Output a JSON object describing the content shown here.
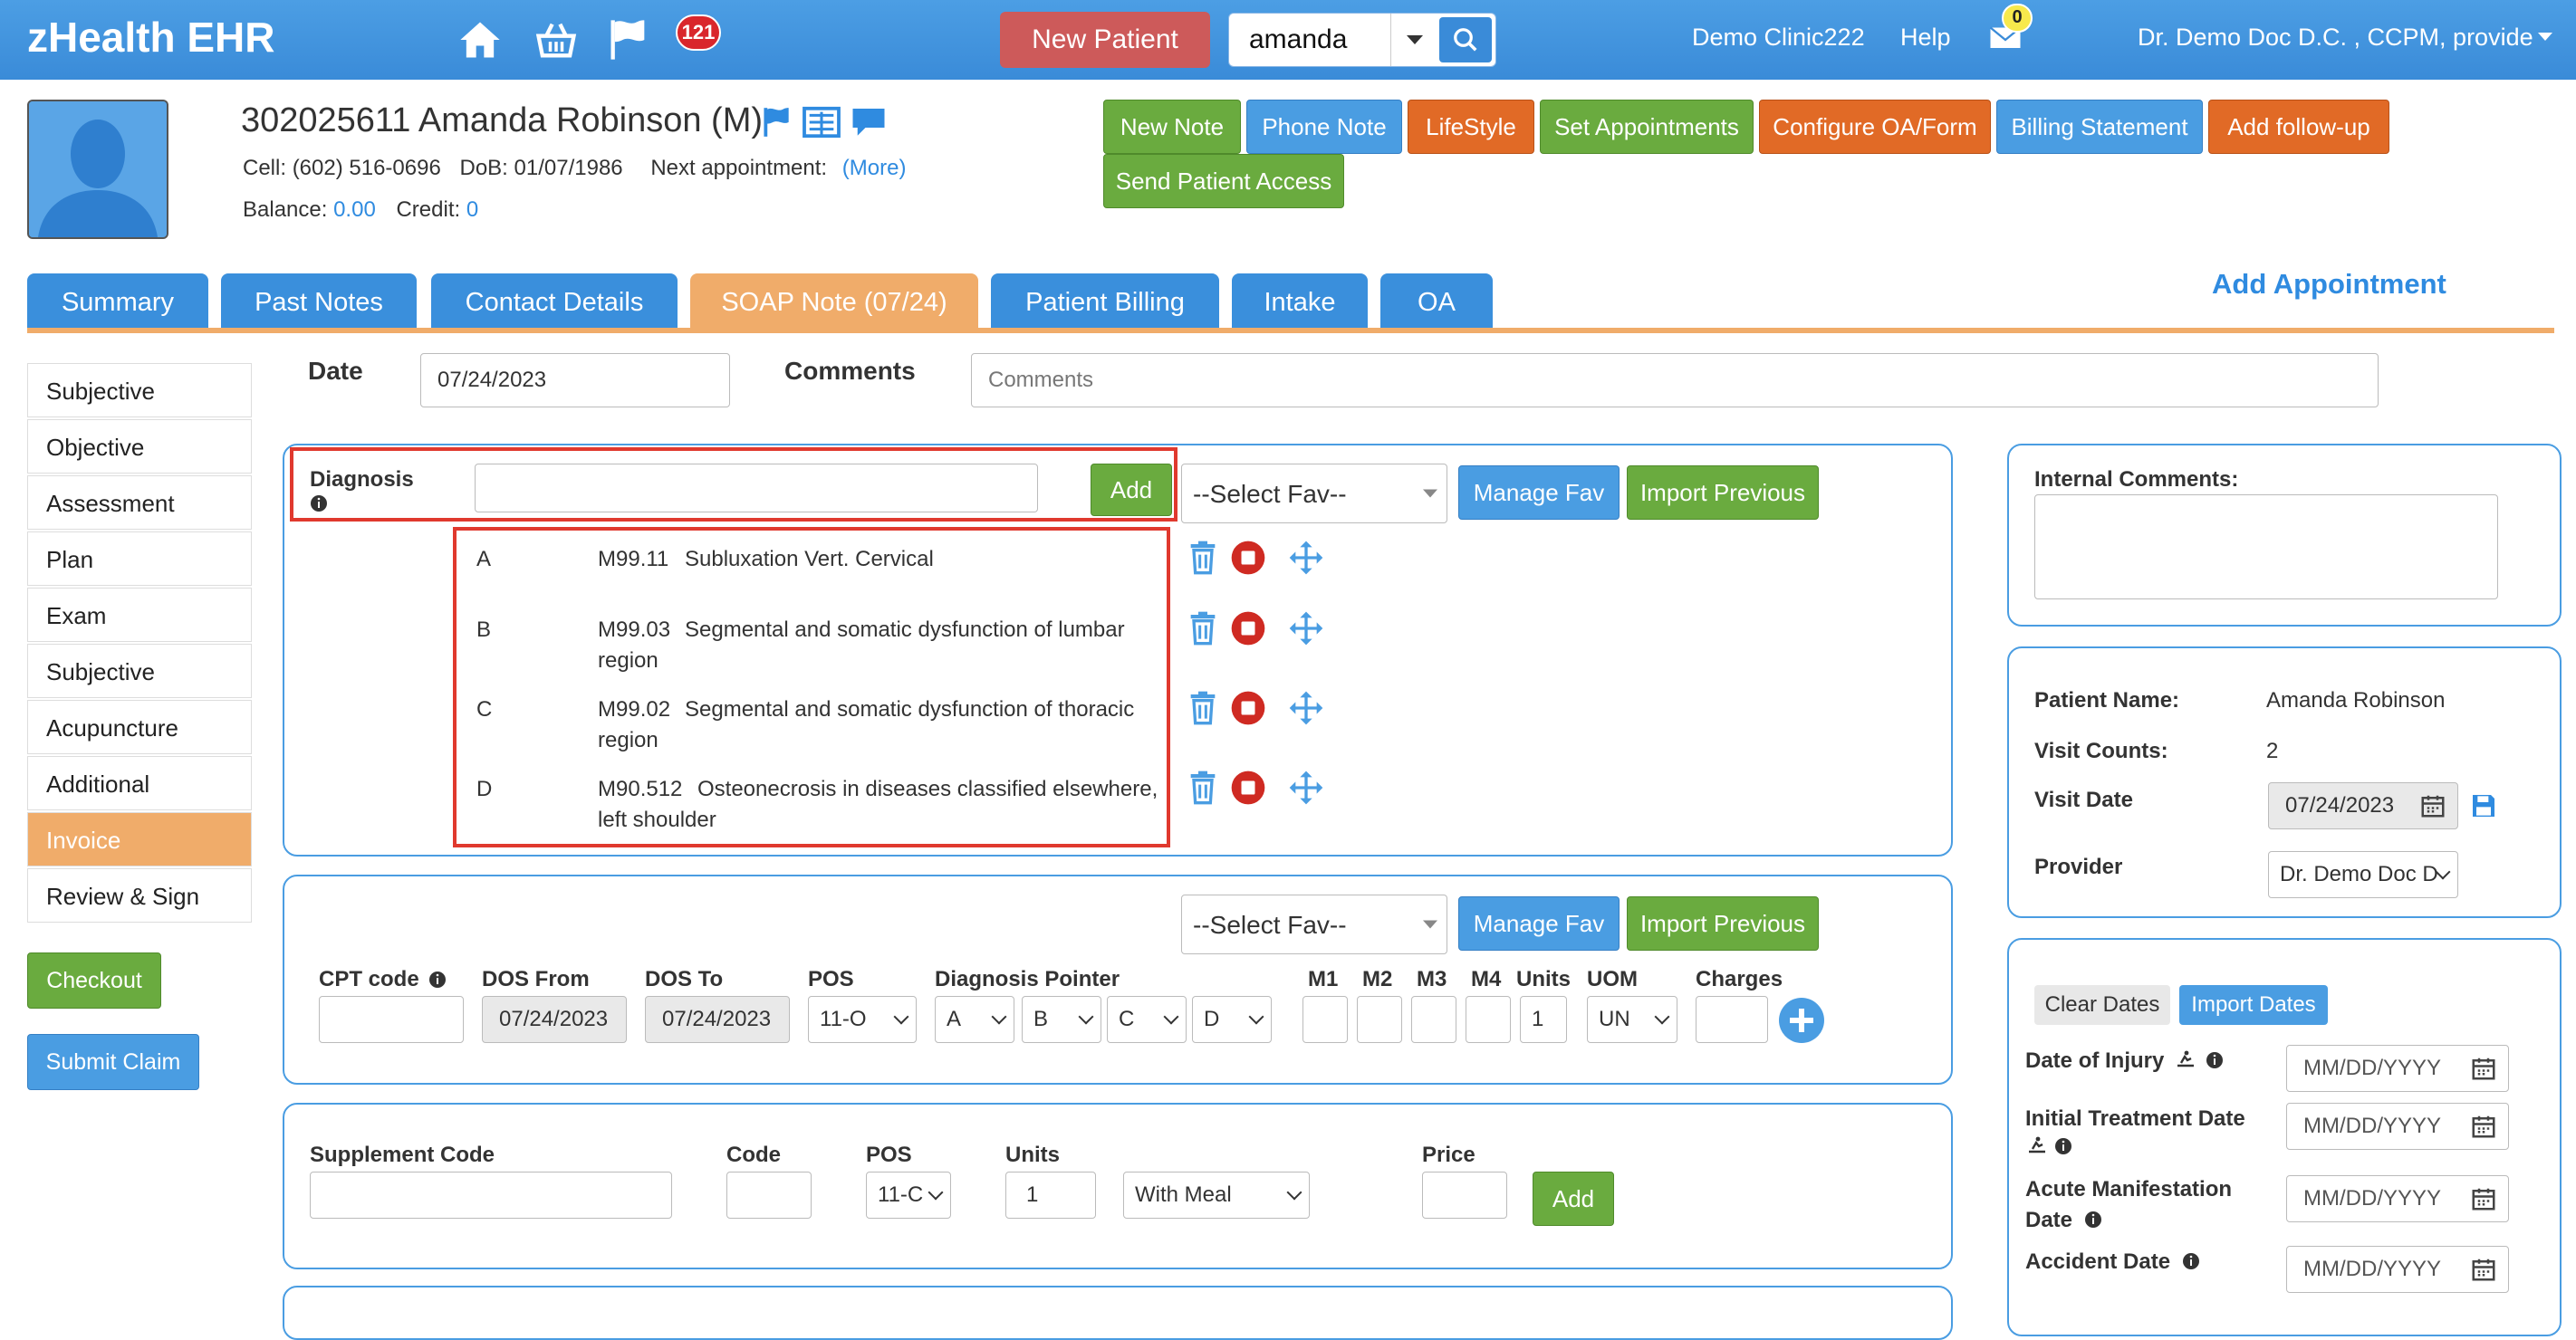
{
  "app": {
    "title": "zHealth EHR",
    "notification_count": "121",
    "message_count": "0"
  },
  "topbar": {
    "new_patient": "New Patient",
    "search_value": "amanda",
    "clinic": "Demo Clinic222",
    "help": "Help",
    "user": "Dr. Demo Doc D.C. , CCPM, provide r"
  },
  "patient": {
    "header": "302025611 Amanda Robinson (M)",
    "cell_label": "Cell:",
    "cell": "(602) 516-0696",
    "dob_label": "DoB:",
    "dob": "01/07/1986",
    "next_label": "Next appointment:",
    "more": "(More)",
    "balance_label": "Balance:",
    "balance": "0.00",
    "credit_label": "Credit:",
    "credit": "0"
  },
  "actions": [
    {
      "label": "New Note",
      "color": "green"
    },
    {
      "label": "Phone Note",
      "color": "blue"
    },
    {
      "label": "LifeStyle",
      "color": "orange"
    },
    {
      "label": "Set Appointments",
      "color": "green"
    },
    {
      "label": "Configure OA/Form",
      "color": "orange"
    },
    {
      "label": "Billing Statement",
      "color": "blue"
    },
    {
      "label": "Add follow-up",
      "color": "orange"
    },
    {
      "label": "Send Patient Access",
      "color": "green"
    }
  ],
  "tabs": [
    "Summary",
    "Past Notes",
    "Contact Details",
    "SOAP Note (07/24)",
    "Patient Billing",
    "Intake",
    "OA"
  ],
  "active_tab": "SOAP Note (07/24)",
  "add_appointment": "Add Appointment",
  "sidebar": {
    "items": [
      "Subjective",
      "Objective",
      "Assessment",
      "Plan",
      "Exam",
      "Subjective",
      "Acupuncture",
      "Additional",
      "Invoice",
      "Review & Sign"
    ],
    "active": "Invoice",
    "checkout": "Checkout",
    "submit_claim": "Submit Claim"
  },
  "note": {
    "date_label": "Date",
    "date": "07/24/2023",
    "comments_label": "Comments",
    "comments_placeholder": "Comments"
  },
  "diagnosis": {
    "label": "Diagnosis",
    "add": "Add",
    "select_fav": "--Select Fav--",
    "manage_fav": "Manage Fav",
    "import_previous": "Import Previous",
    "items": [
      {
        "letter": "A",
        "code": "M99.11",
        "desc": "Subluxation Vert. Cervical",
        "desc2": ""
      },
      {
        "letter": "B",
        "code": "M99.03",
        "desc": "Segmental and somatic dysfunction of lumbar",
        "desc2": "region"
      },
      {
        "letter": "C",
        "code": "M99.02",
        "desc": "Segmental and somatic dysfunction of thoracic",
        "desc2": "region"
      },
      {
        "letter": "D",
        "code": "M90.512",
        "desc": "Osteonecrosis in diseases classified elsewhere,",
        "desc2": "left shoulder"
      }
    ]
  },
  "cpt": {
    "select_fav": "--Select Fav--",
    "manage_fav": "Manage Fav",
    "import_previous": "Import Previous",
    "headers": {
      "cpt_code": "CPT code",
      "dos_from": "DOS From",
      "dos_to": "DOS To",
      "pos": "POS",
      "pointer": "Diagnosis Pointer",
      "m1": "M1",
      "m2": "M2",
      "m3": "M3",
      "m4": "M4",
      "units": "Units",
      "uom": "UOM",
      "charges": "Charges"
    },
    "dos_from": "07/24/2023",
    "dos_to": "07/24/2023",
    "pos": "11-O",
    "pointers": [
      "A",
      "B",
      "C",
      "D"
    ],
    "units": "1",
    "uom": "UN"
  },
  "supplement": {
    "headers": {
      "code_label": "Supplement Code",
      "code": "Code",
      "pos": "POS",
      "units": "Units",
      "price": "Price"
    },
    "pos": "11-C",
    "units": "1",
    "meal": "With Meal",
    "add": "Add"
  },
  "right": {
    "internal_comments": "Internal Comments:",
    "patient_name_label": "Patient Name:",
    "patient_name": "Amanda Robinson",
    "visit_counts_label": "Visit Counts:",
    "visit_counts": "2",
    "visit_date_label": "Visit Date",
    "visit_date": "07/24/2023",
    "provider_label": "Provider",
    "provider": "Dr. Demo Doc D",
    "clear_dates": "Clear Dates",
    "import_dates": "Import Dates",
    "date_of_injury": "Date of Injury",
    "initial_treatment": "Initial Treatment Date",
    "acute_manifestation_1": "Acute Manifestation",
    "acute_manifestation_2": "Date",
    "accident_date": "Accident Date",
    "date_placeholder": "MM/DD/YYYY"
  },
  "colors": {
    "topbar": "#3a8bd8",
    "tab": "#3a8fdc",
    "active_tab": "#f0ac6a",
    "green": "#6aab3f",
    "orange": "#e16a26",
    "red_highlight": "#e0392e"
  }
}
